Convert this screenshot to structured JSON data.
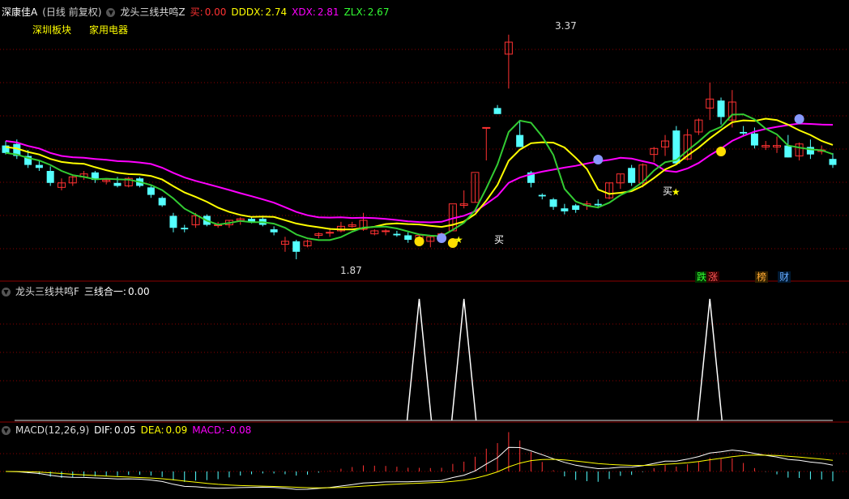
{
  "header": {
    "stock_name": "深康佳A",
    "period": "(日线 前复权)",
    "indicator_main": "龙头三线共鸣Z",
    "buy_label": "买:",
    "buy_value": "0.00",
    "dddx_label": "DDDX:",
    "dddx_value": "2.74",
    "xdx_label": "XDX:",
    "xdx_value": "2.81",
    "zlx_label": "ZLX:",
    "zlx_value": "2.67"
  },
  "sectors": [
    "深圳板块",
    "家用电器"
  ],
  "annotations": {
    "high_label": "3.37",
    "low_label": "1.87",
    "buy_text": "买",
    "sell_tags": [
      "跌",
      "涨",
      "榜",
      "财"
    ]
  },
  "sub1": {
    "title": "龙头三线共鸣F",
    "signal_label": "三线合一:",
    "signal_value": "0.00"
  },
  "macd": {
    "title": "MACD(12,26,9)",
    "dif_label": "DIF:",
    "dif_value": "0.05",
    "dea_label": "DEA:",
    "dea_value": "0.09",
    "macd_label": "MACD:",
    "macd_value": "-0.08"
  },
  "colors": {
    "up": "#ff3232",
    "down": "#54ffff",
    "ma_yellow": "#ffff00",
    "ma_magenta": "#ff00ff",
    "ma_green": "#33cc33",
    "grid": "#8b0000"
  },
  "chart_data": {
    "type": "candlestick",
    "price_range": [
      1.8,
      3.45
    ],
    "candles": [
      [
        2.63,
        2.66,
        2.58,
        2.57
      ],
      [
        2.64,
        2.67,
        2.56,
        2.54
      ],
      [
        2.56,
        2.6,
        2.5,
        2.48
      ],
      [
        2.5,
        2.53,
        2.48,
        2.46
      ],
      [
        2.46,
        2.49,
        2.38,
        2.36
      ],
      [
        2.35,
        2.41,
        2.38,
        2.33
      ],
      [
        2.38,
        2.43,
        2.42,
        2.36
      ],
      [
        2.42,
        2.46,
        2.44,
        2.4
      ],
      [
        2.45,
        2.46,
        2.4,
        2.38
      ],
      [
        2.39,
        2.41,
        2.4,
        2.37
      ],
      [
        2.38,
        2.42,
        2.36,
        2.35
      ],
      [
        2.36,
        2.42,
        2.41,
        2.35
      ],
      [
        2.41,
        2.42,
        2.36,
        2.35
      ],
      [
        2.35,
        2.36,
        2.3,
        2.28
      ],
      [
        2.28,
        2.29,
        2.23,
        2.22
      ],
      [
        2.16,
        2.18,
        2.08,
        2.05
      ],
      [
        2.08,
        2.1,
        2.07,
        2.05
      ],
      [
        2.1,
        2.18,
        2.16,
        2.08
      ],
      [
        2.16,
        2.17,
        2.1,
        2.09
      ],
      [
        2.1,
        2.12,
        2.1,
        2.08
      ],
      [
        2.1,
        2.13,
        2.13,
        2.08
      ],
      [
        2.13,
        2.15,
        2.14,
        2.1
      ],
      [
        2.14,
        2.15,
        2.12,
        2.11
      ],
      [
        2.14,
        2.16,
        2.1,
        2.09
      ],
      [
        2.07,
        2.09,
        2.05,
        2.03
      ],
      [
        1.97,
        2.02,
        1.99,
        1.92
      ],
      [
        1.99,
        2.0,
        1.92,
        1.87
      ],
      [
        1.96,
        2.0,
        1.99,
        1.95
      ],
      [
        2.03,
        2.05,
        2.04,
        2.01
      ],
      [
        2.05,
        2.08,
        2.05,
        2.02
      ],
      [
        2.06,
        2.12,
        2.09,
        2.05
      ],
      [
        2.09,
        2.12,
        2.1,
        2.08
      ],
      [
        2.07,
        2.18,
        2.13,
        2.06
      ],
      [
        2.04,
        2.07,
        2.06,
        2.03
      ],
      [
        2.06,
        2.07,
        2.06,
        2.03
      ],
      [
        2.04,
        2.06,
        2.03,
        2.02
      ],
      [
        2.03,
        2.05,
        2.0,
        1.98
      ],
      [
        2.01,
        2.04,
        2.03,
        1.97
      ],
      [
        1.99,
        2.02,
        2.02,
        1.95
      ],
      [
        2.04,
        2.05,
        2.04,
        2.0
      ],
      [
        2.06,
        2.23,
        2.24,
        2.06
      ],
      [
        2.23,
        2.33,
        2.24,
        2.21
      ],
      [
        2.25,
        2.44,
        2.45,
        2.25
      ],
      [
        2.75,
        2.75,
        2.75,
        2.53
      ],
      [
        2.88,
        2.9,
        2.84,
        2.84
      ],
      [
        3.24,
        3.37,
        3.32,
        3.01
      ],
      [
        2.7,
        2.79,
        2.62,
        2.62
      ],
      [
        2.45,
        2.46,
        2.38,
        2.35
      ],
      [
        2.3,
        2.31,
        2.29,
        2.27
      ],
      [
        2.27,
        2.28,
        2.22,
        2.2
      ],
      [
        2.21,
        2.24,
        2.19,
        2.17
      ],
      [
        2.23,
        2.24,
        2.2,
        2.18
      ],
      [
        2.23,
        2.26,
        2.24,
        2.2
      ],
      [
        2.24,
        2.27,
        2.23,
        2.21
      ],
      [
        2.28,
        2.38,
        2.38,
        2.27
      ],
      [
        2.38,
        2.44,
        2.44,
        2.34
      ],
      [
        2.48,
        2.5,
        2.38,
        2.36
      ],
      [
        2.38,
        2.51,
        2.5,
        2.35
      ],
      [
        2.57,
        2.62,
        2.61,
        2.52
      ],
      [
        2.62,
        2.7,
        2.66,
        2.56
      ],
      [
        2.73,
        2.76,
        2.51,
        2.5
      ],
      [
        2.54,
        2.74,
        2.7,
        2.53
      ],
      [
        2.72,
        2.81,
        2.8,
        2.7
      ],
      [
        2.88,
        3.05,
        2.94,
        2.8
      ],
      [
        2.93,
        2.95,
        2.82,
        2.77
      ],
      [
        2.8,
        3.0,
        2.92,
        2.75
      ],
      [
        2.72,
        2.76,
        2.71,
        2.69
      ],
      [
        2.71,
        2.75,
        2.63,
        2.61
      ],
      [
        2.62,
        2.66,
        2.63,
        2.6
      ],
      [
        2.62,
        2.69,
        2.63,
        2.58
      ],
      [
        2.63,
        2.7,
        2.55,
        2.55
      ],
      [
        2.56,
        2.65,
        2.64,
        2.53
      ],
      [
        2.62,
        2.67,
        2.57,
        2.54
      ],
      [
        2.59,
        2.63,
        2.6,
        2.57
      ],
      [
        2.54,
        2.58,
        2.5,
        2.48
      ]
    ],
    "ma": {
      "yellow_label": "XDX",
      "magenta_label": "DDDX",
      "green_label": "ZLX"
    },
    "signal_spikes": [
      37,
      41,
      63
    ],
    "signal_range": [
      0,
      1
    ]
  }
}
